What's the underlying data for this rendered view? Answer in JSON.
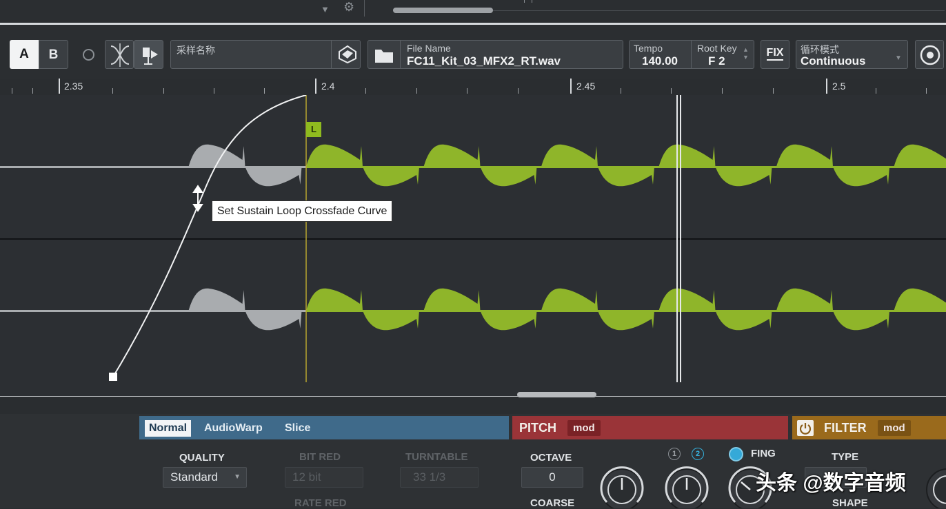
{
  "toolbar": {
    "ab_a": "A",
    "ab_b": "B",
    "preset_label": "采样名称",
    "file_name_label": "File Name",
    "file_name_value": "FC11_Kit_03_MFX2_RT.wav",
    "tempo_label": "Tempo",
    "tempo_value": "140.00",
    "root_key_label": "Root Key",
    "root_key_value": "F  2",
    "fix_label": "FIX",
    "loop_mode_label": "循环模式",
    "loop_mode_value": "Continuous"
  },
  "ruler": {
    "labels": [
      "2.35",
      "2.4",
      "2.45",
      "2.5"
    ]
  },
  "waveform": {
    "tooltip": "Set Sustain Loop Crossfade Curve",
    "loop_marker": "L",
    "colors": {
      "pre_loop": "#a9acaf",
      "loop": "#8fb52a",
      "loop_line": "#b8a530"
    }
  },
  "playback": {
    "tabs": [
      "Normal",
      "AudioWarp",
      "Slice"
    ],
    "quality_label": "QUALITY",
    "quality_value": "Standard",
    "bit_red_label": "BIT RED",
    "bit_red_value": "12 bit",
    "turntable_label": "TURNTABLE",
    "turntable_value": "33 1/3",
    "rate_red_label": "RATE RED"
  },
  "pitch": {
    "title": "PITCH",
    "mod": "mod",
    "octave_label": "OCTAVE",
    "octave_value": "0",
    "coarse_label": "COARSE",
    "badge_1": "1",
    "badge_2": "2",
    "fing_label": "FING",
    "color": "#9a3438"
  },
  "filter": {
    "title": "FILTER",
    "mod": "mod",
    "type_label": "TYPE",
    "shape_label": "SHAPE",
    "color": "#9a6a1c"
  },
  "watermark": "头条 @数字音频"
}
